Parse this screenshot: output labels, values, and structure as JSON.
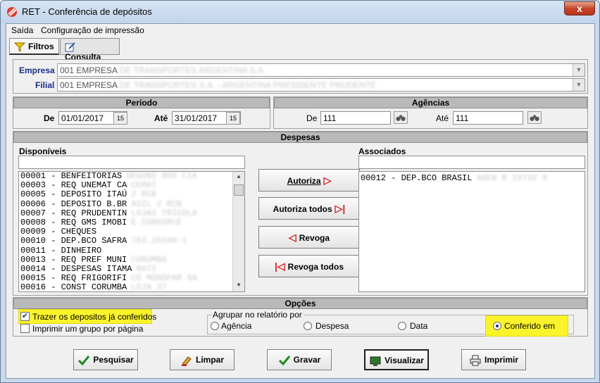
{
  "window": {
    "title": "RET - Conferência de depósitos",
    "close_glyph": "x"
  },
  "menu": {
    "items": [
      "Saída",
      "Configuração de impressão"
    ]
  },
  "tabs": [
    {
      "label": "Filtros",
      "icon": "filter-icon"
    },
    {
      "label": "Consulta",
      "icon": "edit-icon"
    }
  ],
  "empresa": {
    "label": "Empresa",
    "value": "001 EMPRESA",
    "hidden_suffix": "DE TRANSPORTES ARGENTINA S.A."
  },
  "filial": {
    "label": "Filial",
    "value": "001 EMPRESA",
    "hidden_suffix": "DE TRANSPORTES S.A. - ARGENTINA PRESIDENTE PRUDENTE"
  },
  "periodo": {
    "title": "Período",
    "de_label": "De",
    "de_value": "01/01/2017",
    "ate_label": "Até",
    "ate_value": "31/01/2017",
    "cal_glyph": "15"
  },
  "agencias": {
    "title": "Agências",
    "de_label": "De",
    "de_value": "111",
    "ate_label": "Até",
    "ate_value": "111"
  },
  "despesas": {
    "title": "Despesas",
    "disponiveis_label": "Disponíveis",
    "associados_label": "Associados",
    "disponiveis": [
      {
        "text": "00001 - BENFEITORIAS",
        "hidden": "SEGURO RGS CIA"
      },
      {
        "text": "00003 - REQ UNEMAT CA",
        "hidden": "CEMAT"
      },
      {
        "text": "00005 - DEPOSITO ITAÚ",
        "hidden": "2 RCB"
      },
      {
        "text": "00006 - DEPOSITO B.BR",
        "hidden": "ASIL 2 RCB"
      },
      {
        "text": "00007 - REQ PRUDENTIN",
        "hidden": "LOJAS TRICOLA"
      },
      {
        "text": "00008 - REQ GMS IMOBI",
        "hidden": "E CONSORCE"
      },
      {
        "text": "00009 - CHEQUES",
        "hidden": ""
      },
      {
        "text": "00010 - DEP.BCO SAFRA",
        "hidden": "783.20340-1"
      },
      {
        "text": "00011 - DINHEIRO",
        "hidden": ""
      },
      {
        "text": "00013 - REQ PREF MUNI",
        "hidden": "CORUMBA"
      },
      {
        "text": "00014 - DESPESAS ITAMA",
        "hidden": "RATI"
      },
      {
        "text": "00015 - REQ FRIGORIFI",
        "hidden": "CO MONDPAR SA"
      },
      {
        "text": "00016 - CONST CORUMBA",
        "hidden": "LOJA 37"
      }
    ],
    "associados": [
      {
        "text": "00012 - DEP.BCO BRASIL",
        "hidden": "AGEN R 19732 9"
      }
    ],
    "buttons": {
      "autoriza": "Autoriza",
      "autoriza_todos": "Autoriza todos",
      "revoga": "Revoga",
      "revoga_todos": "Revoga todos"
    }
  },
  "opcoes": {
    "title": "Opções",
    "trazer_label": "Trazer os depositos já conferidos",
    "trazer_checked": true,
    "imprimir_label": "Imprimir um grupo por página",
    "imprimir_checked": false,
    "agrupar_label": "Agrupar no relatório por",
    "agrupar_options": [
      "Agência",
      "Despesa",
      "Data",
      "Conferido em"
    ],
    "agrupar_selected": "Conferido em"
  },
  "footer": {
    "pesquisar": "Pesquisar",
    "limpar": "Limpar",
    "gravar": "Gravar",
    "visualizar": "Visualizar",
    "imprimir": "Imprimir"
  },
  "colors": {
    "highlight": "#fbf42a",
    "label_blue": "#1a2f8a",
    "arrow_red": "#d32020",
    "check_green": "#1b8a1b"
  }
}
